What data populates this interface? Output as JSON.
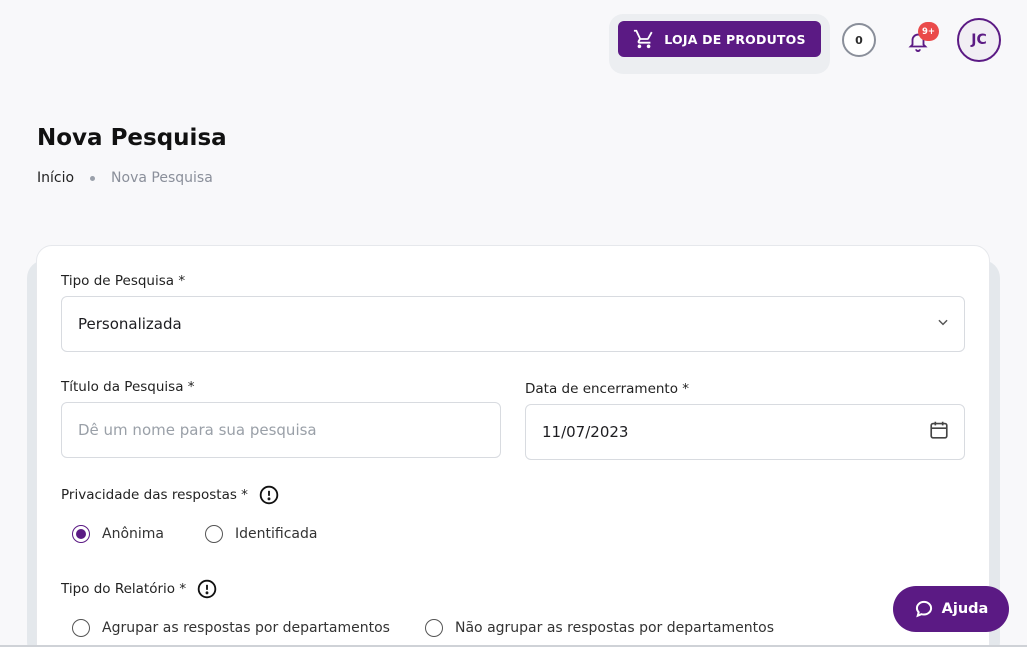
{
  "header": {
    "store_button": "LOJA DE PRODUTOS",
    "counter": "0",
    "notifications_badge": "9+",
    "avatar_initials": "JC"
  },
  "page": {
    "title": "Nova Pesquisa",
    "breadcrumb": {
      "home": "Início",
      "current": "Nova Pesquisa"
    }
  },
  "form": {
    "survey_type": {
      "label": "Tipo de Pesquisa *",
      "value": "Personalizada"
    },
    "survey_title": {
      "label": "Título da Pesquisa *",
      "placeholder": "Dê um nome para sua pesquisa",
      "value": ""
    },
    "end_date": {
      "label": "Data de encerramento *",
      "value": "11/07/2023"
    },
    "privacy": {
      "label": "Privacidade das respostas *",
      "options": [
        "Anônima",
        "Identificada"
      ],
      "selected": "Anônima"
    },
    "report_type": {
      "label": "Tipo do Relatório *",
      "options": [
        "Agrupar as respostas por departamentos",
        "Não agrupar as respostas por departamentos"
      ],
      "selected": ""
    }
  },
  "help_button": "Ajuda",
  "icons": {
    "cart": "cart-icon",
    "bell": "bell-icon",
    "chevron": "chevron-down-icon",
    "calendar": "calendar-icon",
    "info": "info-icon",
    "chat": "chat-bubble-icon"
  },
  "colors": {
    "brand": "#5b1a84",
    "badge": "#ea4a4a",
    "background": "#f8f8fa"
  }
}
